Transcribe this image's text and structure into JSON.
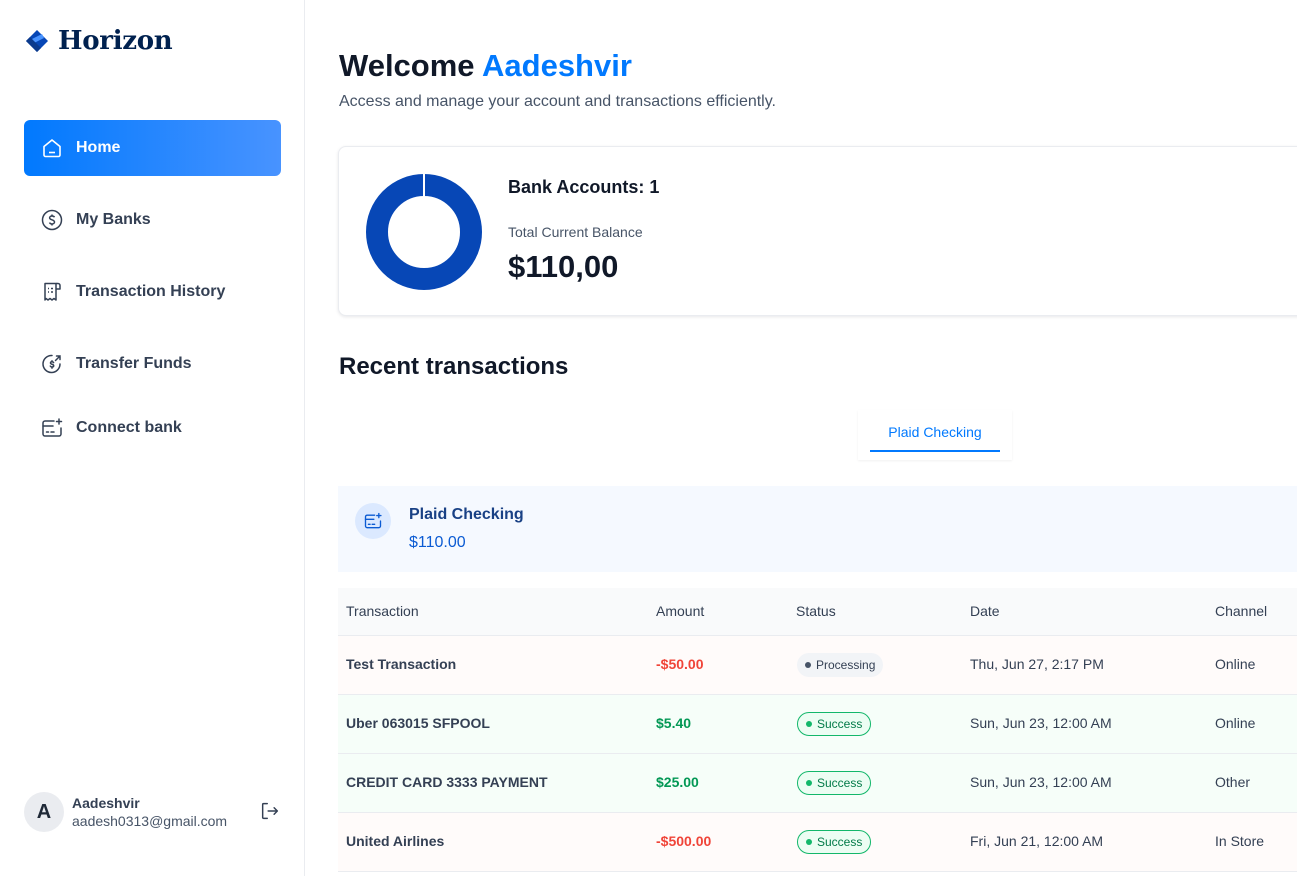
{
  "app": {
    "name": "Horizon"
  },
  "sidebar": {
    "items": [
      {
        "label": "Home",
        "icon": "home-icon",
        "active": true
      },
      {
        "label": "My Banks",
        "icon": "dollar-circle-icon",
        "active": false
      },
      {
        "label": "Transaction History",
        "icon": "receipt-icon",
        "active": false
      },
      {
        "label": "Transfer Funds",
        "icon": "money-send-icon",
        "active": false
      },
      {
        "label": "Connect bank",
        "icon": "card-add-icon",
        "active": false
      }
    ],
    "user": {
      "initial": "A",
      "name": "Aadeshvir",
      "email": "aadesh0313@gmail.com"
    }
  },
  "header": {
    "welcome": "Welcome",
    "user_name": "Aadeshvir",
    "subtitle": "Access and manage your account and transactions efficiently."
  },
  "balance": {
    "accounts_label": "Bank Accounts: 1",
    "total_label": "Total Current Balance",
    "total_value": "$110,00"
  },
  "recent": {
    "title": "Recent transactions",
    "tabs": [
      {
        "label": "Plaid Checking",
        "active": true
      }
    ],
    "bank": {
      "name": "Plaid Checking",
      "balance": "$110.00"
    },
    "columns": [
      "Transaction",
      "Amount",
      "Status",
      "Date",
      "Channel"
    ],
    "rows": [
      {
        "name": "Test Transaction",
        "amount": "-$50.00",
        "type": "debit",
        "status": "Processing",
        "date": "Thu, Jun 27, 2:17 PM",
        "channel": "Online"
      },
      {
        "name": "Uber 063015 SFPOOL",
        "amount": "$5.40",
        "type": "credit",
        "status": "Success",
        "date": "Sun, Jun 23, 12:00 AM",
        "channel": "Online"
      },
      {
        "name": "CREDIT CARD 3333 PAYMENT",
        "amount": "$25.00",
        "type": "credit",
        "status": "Success",
        "date": "Sun, Jun 23, 12:00 AM",
        "channel": "Other"
      },
      {
        "name": "United Airlines",
        "amount": "-$500.00",
        "type": "debit",
        "status": "Success",
        "date": "Fri, Jun 21, 12:00 AM",
        "channel": "In Store"
      }
    ]
  },
  "colors": {
    "accent": "#0179fe",
    "donut": "#0747b6",
    "debit": "#f04438",
    "credit": "#039855"
  }
}
